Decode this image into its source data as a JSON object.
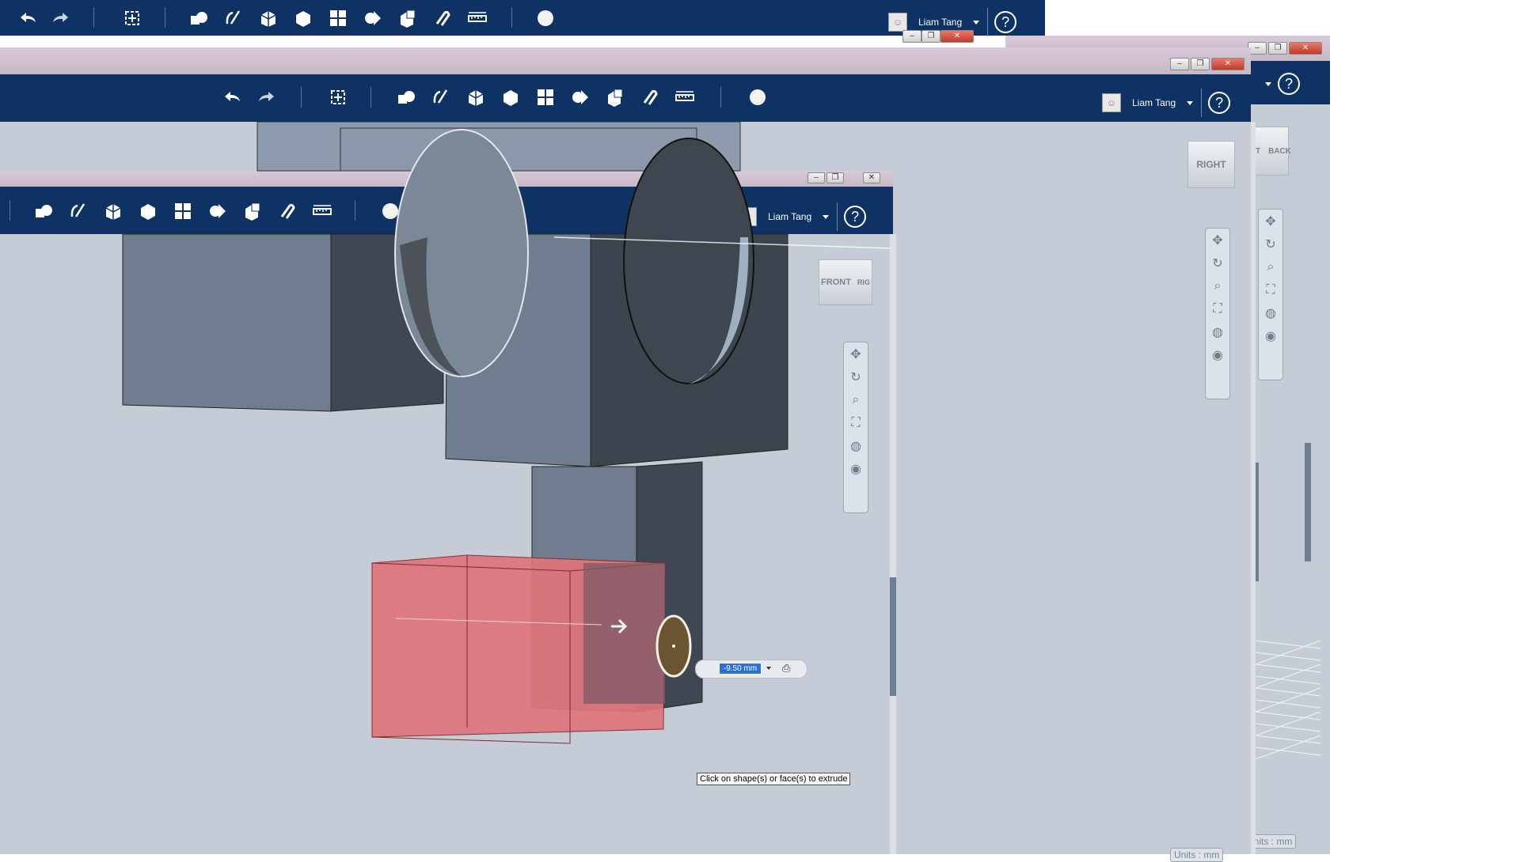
{
  "user": {
    "name": "Liam Tang"
  },
  "help_label": "?",
  "viewcube": {
    "front_window": {
      "front": "FRONT",
      "side": "RIG"
    },
    "mid_window": {
      "face": "RIGHT"
    },
    "back_window": {
      "left": "RIGHT",
      "right": "BACK"
    }
  },
  "dimension_input": {
    "value": "-9.50 mm"
  },
  "tooltip": "Click on shape(s) or face(s) to extrude",
  "units_label": "Units : mm",
  "colors": {
    "toolbar": "#0e3263",
    "viewport": "#c5ccd6",
    "selection": "#e0757b"
  }
}
